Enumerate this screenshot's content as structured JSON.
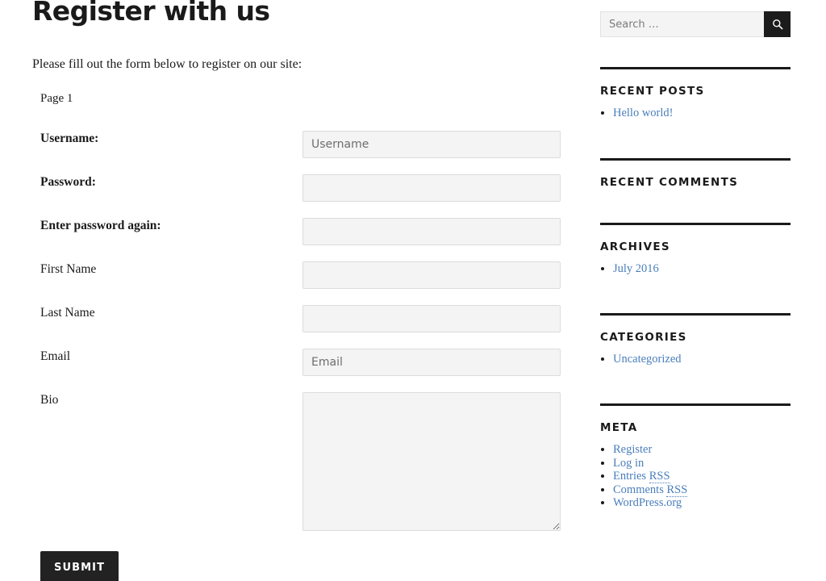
{
  "main": {
    "title": "Register with us",
    "intro": "Please fill out the form below to register on our site:",
    "page_marker": "Page 1",
    "submit_label": "Submit",
    "fields": [
      {
        "label": "Username:",
        "required": true,
        "type": "text",
        "value": "",
        "placeholder": "Username"
      },
      {
        "label": "Password:",
        "required": true,
        "type": "password",
        "value": "",
        "placeholder": ""
      },
      {
        "label": "Enter password again:",
        "required": true,
        "type": "password",
        "value": "",
        "placeholder": ""
      },
      {
        "label": "First Name",
        "required": false,
        "type": "text",
        "value": "",
        "placeholder": ""
      },
      {
        "label": "Last Name",
        "required": false,
        "type": "text",
        "value": "",
        "placeholder": ""
      },
      {
        "label": "Email",
        "required": false,
        "type": "email",
        "value": "",
        "placeholder": "Email"
      },
      {
        "label": "Bio",
        "required": false,
        "type": "textarea",
        "value": "",
        "placeholder": ""
      }
    ]
  },
  "sidebar": {
    "search": {
      "placeholder": "Search …",
      "value": "",
      "button_icon": "search-icon"
    },
    "widgets": [
      {
        "id": "recent-posts",
        "title": "Recent Posts",
        "items": [
          {
            "label": "Hello world!"
          }
        ]
      },
      {
        "id": "recent-comments",
        "title": "Recent Comments",
        "items": []
      },
      {
        "id": "archives",
        "title": "Archives",
        "items": [
          {
            "label": "July 2016"
          }
        ]
      },
      {
        "id": "categories",
        "title": "Categories",
        "items": [
          {
            "label": "Uncategorized"
          }
        ]
      },
      {
        "id": "meta",
        "title": "Meta",
        "items": [
          {
            "label": "Register"
          },
          {
            "label": "Log in"
          },
          {
            "label": "Entries ",
            "abbr": "RSS"
          },
          {
            "label": "Comments ",
            "abbr": "RSS"
          },
          {
            "label": "WordPress.org"
          }
        ]
      }
    ]
  },
  "colors": {
    "link": "#4a7ebb",
    "rule": "#1a1a1a",
    "button": "#222222",
    "search_button": "#1c1c1c",
    "field_bg": "#f4f4f4",
    "field_border": "#dcdcdc",
    "text": "#1a1a1a"
  }
}
